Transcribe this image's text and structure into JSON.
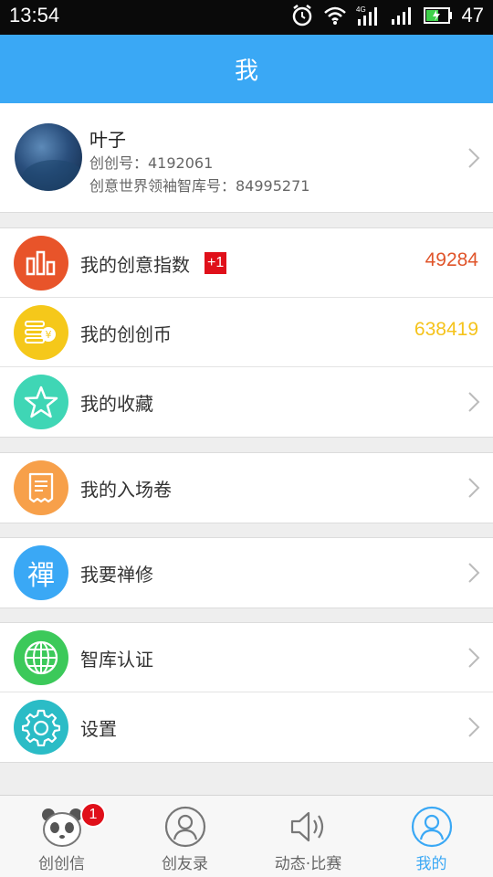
{
  "status_bar": {
    "time": "13:54",
    "battery": "47",
    "network": "4G"
  },
  "header": {
    "title": "我"
  },
  "profile": {
    "name": "叶子",
    "id_line": "创创号：4192061",
    "library_line": "创意世界领袖智库号：84995271"
  },
  "menu": {
    "creative_index": {
      "label": "我的创意指数",
      "badge": "+1",
      "value": "49284",
      "color": "#e0552b"
    },
    "coins": {
      "label": "我的创创币",
      "value": "638419",
      "color": "#f5c31c"
    },
    "favorites": {
      "label": "我的收藏"
    },
    "tickets": {
      "label": "我的入场卷"
    },
    "zen": {
      "label": "我要禅修",
      "icon_char": "禪"
    },
    "certify": {
      "label": "智库认证"
    },
    "settings": {
      "label": "设置"
    }
  },
  "nav": {
    "items": [
      {
        "label": "创创信",
        "badge": "1"
      },
      {
        "label": "创友录"
      },
      {
        "label": "动态·比赛"
      },
      {
        "label": "我的"
      }
    ],
    "active_color": "#3aa8f5"
  },
  "colors": {
    "accent": "#3aa8f5",
    "orange_red": "#e8542a",
    "yellow": "#f5c81a",
    "teal": "#3fd6b5",
    "orange": "#f7a04a",
    "blue": "#3aa8f5",
    "green": "#3cc95a",
    "cyan": "#2bbcc6"
  }
}
